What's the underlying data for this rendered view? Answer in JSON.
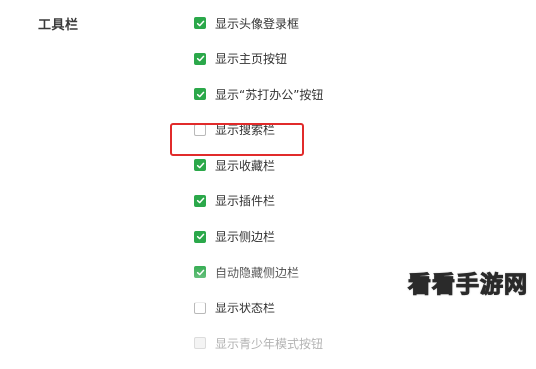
{
  "section": {
    "title": "工具栏"
  },
  "options": [
    {
      "label": "显示头像登录框",
      "checked": true,
      "disabled": false
    },
    {
      "label": "显示主页按钮",
      "checked": true,
      "disabled": false
    },
    {
      "label": "显示“苏打办公”按钮",
      "checked": true,
      "disabled": false
    },
    {
      "label": "显示搜索栏",
      "checked": false,
      "disabled": false
    },
    {
      "label": "显示收藏栏",
      "checked": true,
      "disabled": false
    },
    {
      "label": "显示插件栏",
      "checked": true,
      "disabled": false
    },
    {
      "label": "显示侧边栏",
      "checked": true,
      "disabled": false
    },
    {
      "label": "自动隐藏侧边栏",
      "checked": true,
      "disabled": false
    },
    {
      "label": "显示状态栏",
      "checked": false,
      "disabled": false
    },
    {
      "label": "显示青少年模式按钮",
      "checked": false,
      "disabled": true
    }
  ],
  "watermark": {
    "text": "看看手游网"
  },
  "colors": {
    "checkbox_checked": "#2ba84a",
    "highlight_border": "#e12b2b"
  },
  "icons": {
    "check": "checkmark-icon"
  }
}
